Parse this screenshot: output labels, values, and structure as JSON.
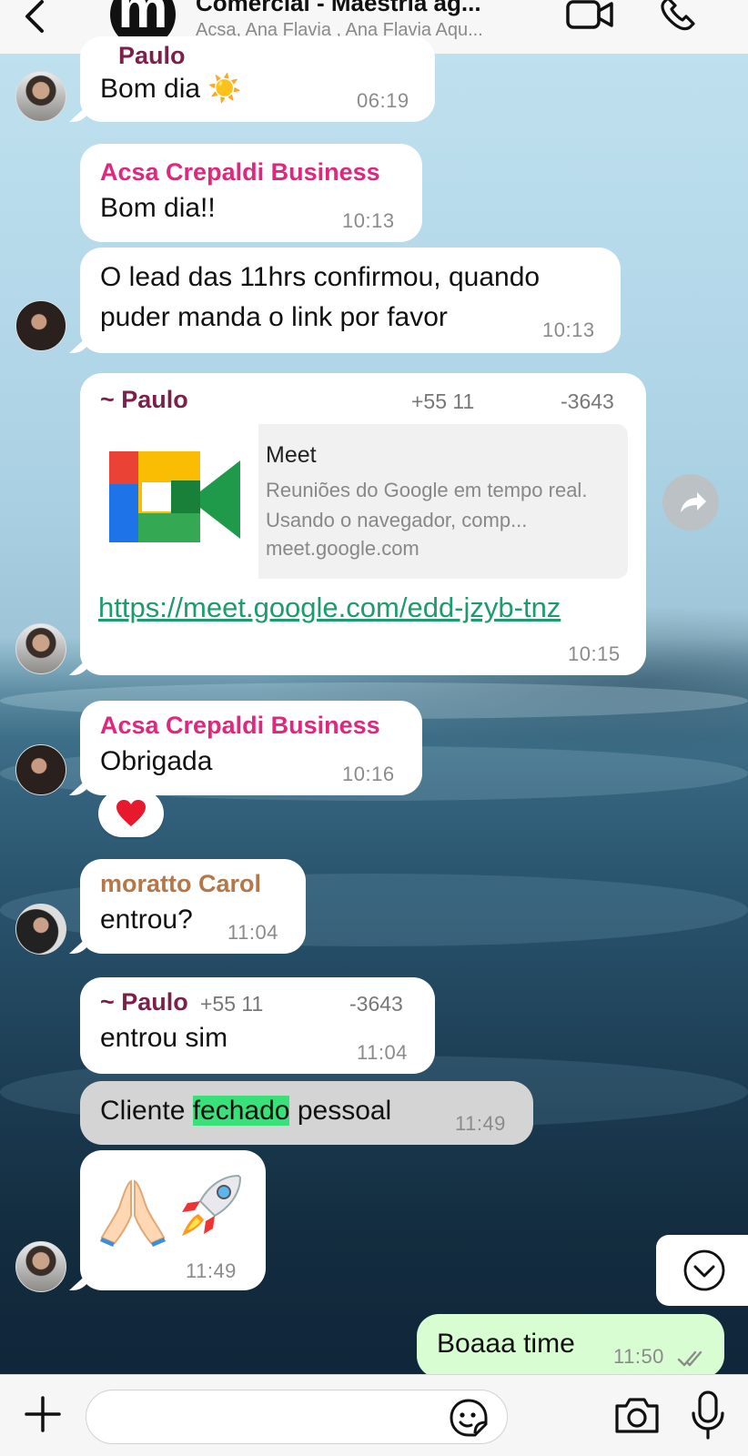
{
  "header": {
    "avatar_letter": "m",
    "title": "Comercial - Maestria ag...",
    "subtitle": "Acsa, Ana Flavia , Ana Flavia Aqu..."
  },
  "messages": [
    {
      "sender": "Paulo",
      "text": "Bom dia ☀️",
      "time": "06:19"
    },
    {
      "sender": "Acsa Crepaldi Business",
      "text": "Bom dia!!",
      "time": "10:13"
    },
    {
      "text_line1": "O lead das 11hrs confirmou, quando",
      "text_line2": "puder manda o link por favor",
      "time": "10:13"
    },
    {
      "sender": "~ Paulo",
      "phone_prefix": "+55 11",
      "phone_suffix": "-3643",
      "link_title": "Meet",
      "link_desc": "Reuniões do Google em tempo real. Usando o navegador, comp...",
      "link_domain": "meet.google.com",
      "link_url": "https://meet.google.com/edd-jzyb-tnz",
      "time": "10:15"
    },
    {
      "sender": "Acsa Crepaldi Business",
      "text": "Obrigada",
      "time": "10:16",
      "reaction": "❤️"
    },
    {
      "sender": "moratto Carol",
      "text": "entrou?",
      "time": "11:04"
    },
    {
      "sender": "~ Paulo",
      "phone_prefix": "+55 11",
      "phone_suffix": "-3643",
      "text": "entrou sim",
      "time": "11:04"
    },
    {
      "text_before": "Cliente ",
      "text_highlight": "fechado",
      "text_after": " pessoal",
      "time": "11:49"
    },
    {
      "time": "11:49"
    },
    {
      "text": "Boaaa time",
      "time": "11:50"
    }
  ],
  "colors": {
    "sender_acsa": "#e0267d",
    "sender_paulo": "#7b1f4b",
    "sender_carol": "#b4774a",
    "link": "#1d9b6c",
    "highlight": "#3ae07a",
    "outgoing_bubble": "#d9fdd3",
    "ticks": "#8b8b8b"
  },
  "input": {
    "placeholder": "",
    "value": ""
  }
}
